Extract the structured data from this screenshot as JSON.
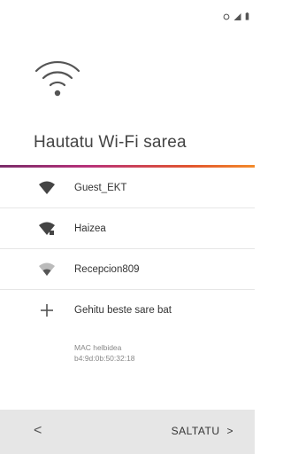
{
  "status_bar": {
    "icons": [
      "alarm-icon",
      "signal-icon",
      "battery-icon"
    ]
  },
  "header": {
    "title": "Hautatu Wi-Fi sarea",
    "icon": "wifi-icon"
  },
  "networks": [
    {
      "name": "Guest_EKT",
      "icon": "wifi-full-icon"
    },
    {
      "name": "Haizea",
      "icon": "wifi-locked-icon"
    },
    {
      "name": "Recepcion809",
      "icon": "wifi-weak-icon"
    }
  ],
  "add_network": {
    "label": "Gehitu beste sare bat",
    "icon": "plus-icon"
  },
  "mac": {
    "label": "MAC helbidea",
    "value": "b4:9d:0b:50:32:18"
  },
  "footer": {
    "back_label": "<",
    "skip_label": "SALTATU",
    "skip_chevron": ">"
  },
  "colors": {
    "accent_start": "#7b2d6a",
    "accent_end": "#f38b2b",
    "footer_bg": "#e6e6e6"
  }
}
